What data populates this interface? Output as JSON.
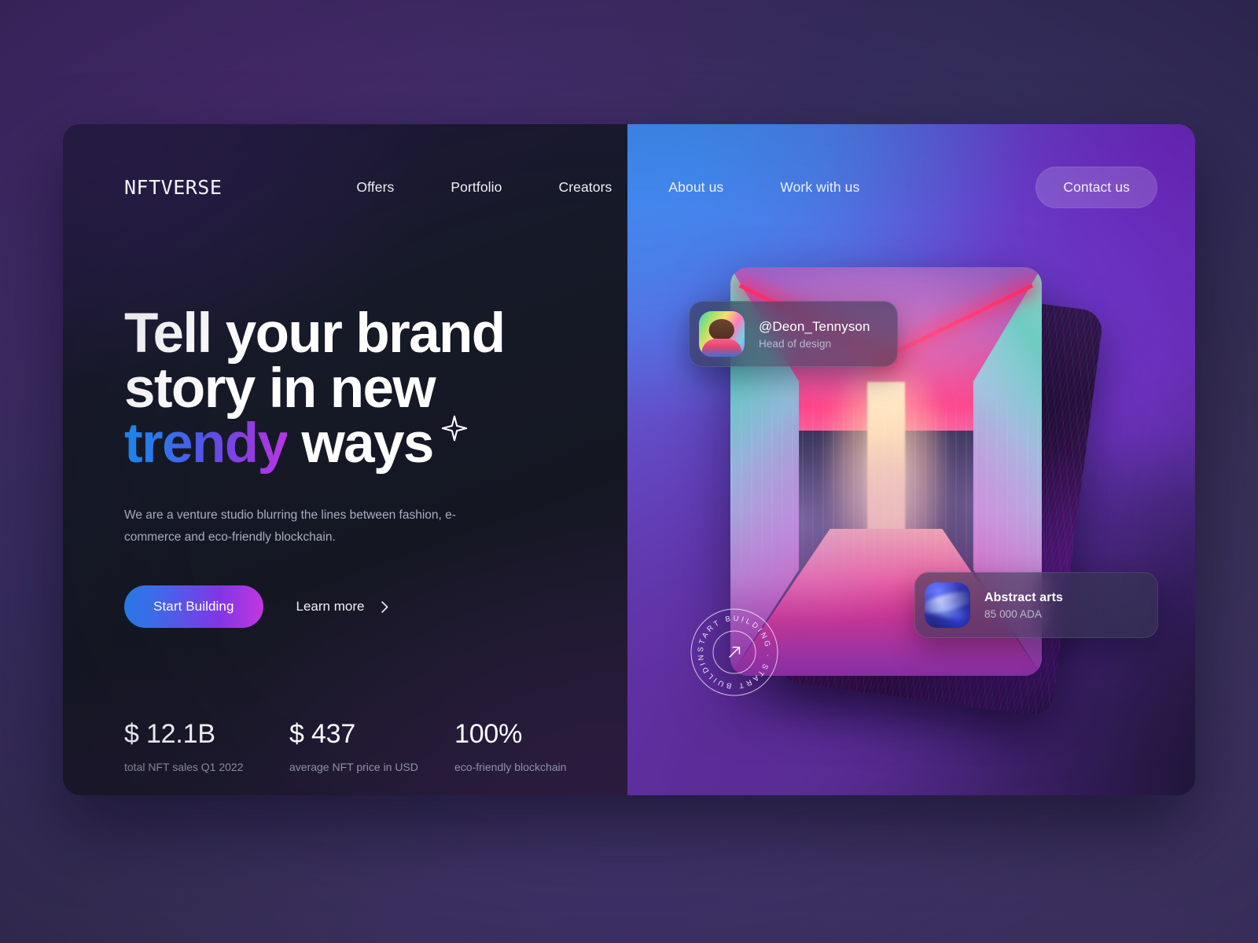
{
  "brand": {
    "logo": "NFTVERSE"
  },
  "nav": {
    "links": [
      {
        "label": "Offers"
      },
      {
        "label": "Portfolio"
      },
      {
        "label": "Creators"
      },
      {
        "label": "About us"
      },
      {
        "label": "Work with us"
      }
    ],
    "cta": {
      "label": "Contact us"
    }
  },
  "hero": {
    "headline_line1": "Tell your brand",
    "headline_line2": "story in new",
    "headline_line3_gradient": "trendy",
    "headline_line3_rest": " ways",
    "sparkle_icon": "sparkle-star-icon",
    "subtext": "We are a venture studio blurring the lines between fashion, e-commerce and eco-friendly blockchain.",
    "primary_cta": "Start Building",
    "secondary_cta": "Learn more",
    "secondary_cta_icon": "chevron-right-icon"
  },
  "stats": [
    {
      "value": "$ 12.1B",
      "label": "total NFT sales Q1 2022"
    },
    {
      "value": "$ 437",
      "label": "average NFT price in USD"
    },
    {
      "value": "100%",
      "label": "eco-friendly blockchain"
    }
  ],
  "showcase": {
    "author_chip": {
      "handle": "@Deon_Tennyson",
      "role": "Head of design",
      "avatar_icon": "user-avatar-photo"
    },
    "nft_chip": {
      "title": "Abstract arts",
      "price": "85 000 ADA",
      "thumb_icon": "abstract-art-thumbnail"
    },
    "badge": {
      "text": "START BUILDING · START BUILDING · ",
      "arrow_icon": "arrow-up-right-icon"
    }
  },
  "colors": {
    "accent_blue": "#2b7ef0",
    "accent_purple": "#8036e4",
    "accent_magenta": "#c337e0",
    "dark_pane": "#161a28",
    "page_bg": "#3a3062",
    "text_primary": "#ffffff",
    "text_muted": "#8f93a7"
  }
}
